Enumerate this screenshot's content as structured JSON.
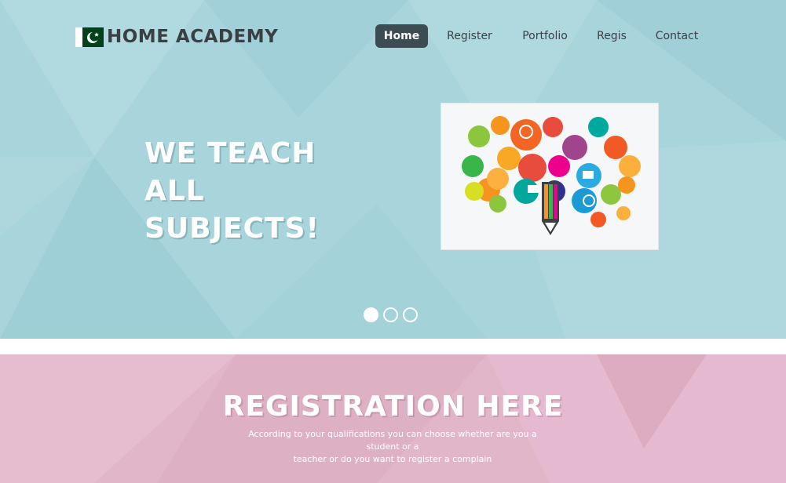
{
  "brand": {
    "name": "HOME ACADEMY",
    "flag_colors": {
      "green": "#01411c",
      "white": "#ffffff"
    }
  },
  "nav": {
    "items": [
      {
        "label": "Home",
        "active": true
      },
      {
        "label": "Register",
        "active": false
      },
      {
        "label": "Portfolio",
        "active": false
      },
      {
        "label": "Regis",
        "active": false
      },
      {
        "label": "Contact",
        "active": false
      }
    ]
  },
  "hero": {
    "headline_line1": "WE TEACH ALL",
    "headline_line2": "SUBJECTS!",
    "background_color": "#a8d5dc",
    "image_icon": "education-bubbles-illustration",
    "slides_total": 3,
    "active_slide": 1
  },
  "registration": {
    "title": "REGISTRATION HERE",
    "description_line1": "According to your qualifications you can choose whether are you a student or a",
    "description_line2": "teacher or do you want to register a complain",
    "background_color": "#e2b6c9"
  }
}
